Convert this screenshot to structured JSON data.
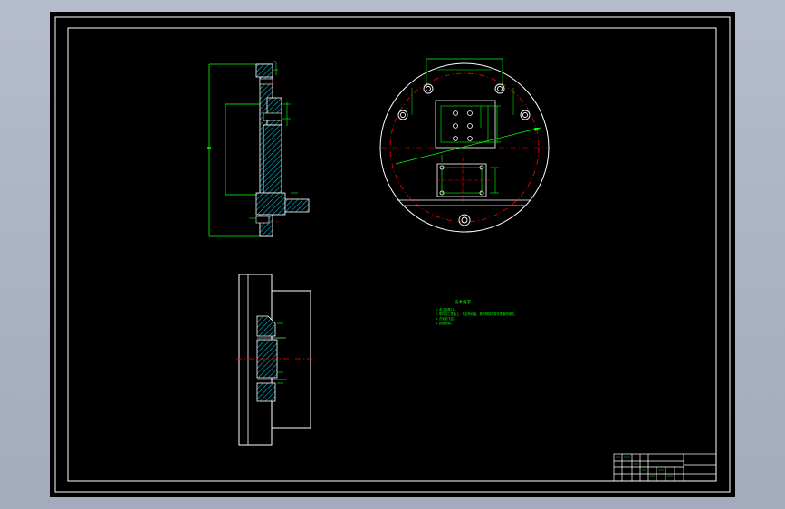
{
  "drawing": {
    "notes_title": "技术要求",
    "notes_lines": [
      "1.未注倒角C1。",
      "2.零件加工表面上，不应有划痕、擦伤等损伤零件表面的缺陷。",
      "3.去毛刺飞边。",
      "4.锐角倒钝。"
    ]
  },
  "colors": {
    "sheet": "#000000",
    "outline": "#ffffff",
    "dimension": "#00ff00",
    "centerline": "#ff0000",
    "hatch": "#00bcd4"
  }
}
